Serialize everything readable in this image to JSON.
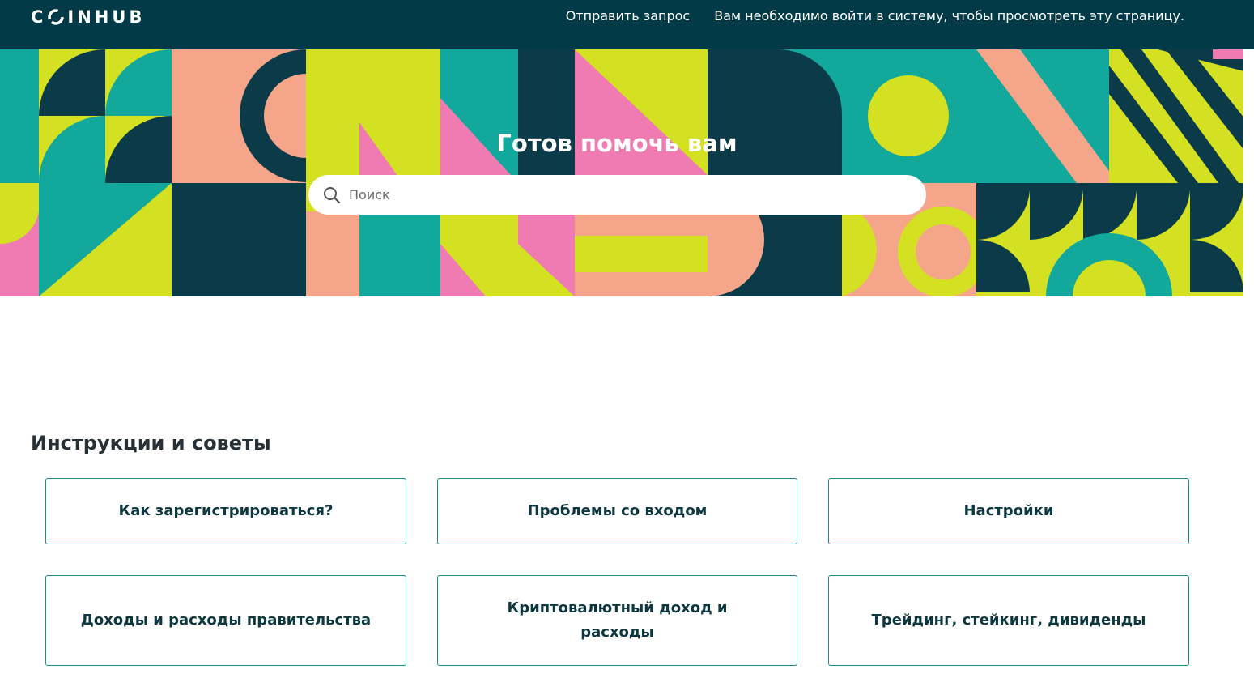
{
  "header": {
    "logo_text": "C INHUB",
    "nav": {
      "submit_request": "Отправить запрос",
      "login_notice": "Вам необходимо войти в систему, чтобы просмотреть эту страницу."
    }
  },
  "hero": {
    "title": "Готов помочь вам",
    "search": {
      "placeholder": "Поиск",
      "value": ""
    }
  },
  "section": {
    "title": "Инструкции и советы",
    "cards": [
      {
        "label": "Как зарегистрироваться?"
      },
      {
        "label": "Проблемы со входом"
      },
      {
        "label": "Настройки"
      },
      {
        "label": "Доходы и расходы правительства"
      },
      {
        "label": "Криптовалютный доход и расходы"
      },
      {
        "label": "Трейдинг, стейкинг, дивиденды"
      }
    ]
  },
  "colors": {
    "header_bg": "#033a47",
    "teal": "#12a89c",
    "navy": "#0b3a48",
    "lime": "#d4e022",
    "pink": "#f07bb2",
    "peach": "#f5a589",
    "card_border": "#1b8d8b"
  },
  "icons": {
    "search": "search-icon",
    "logo_ring": "coin-ring-icon"
  }
}
